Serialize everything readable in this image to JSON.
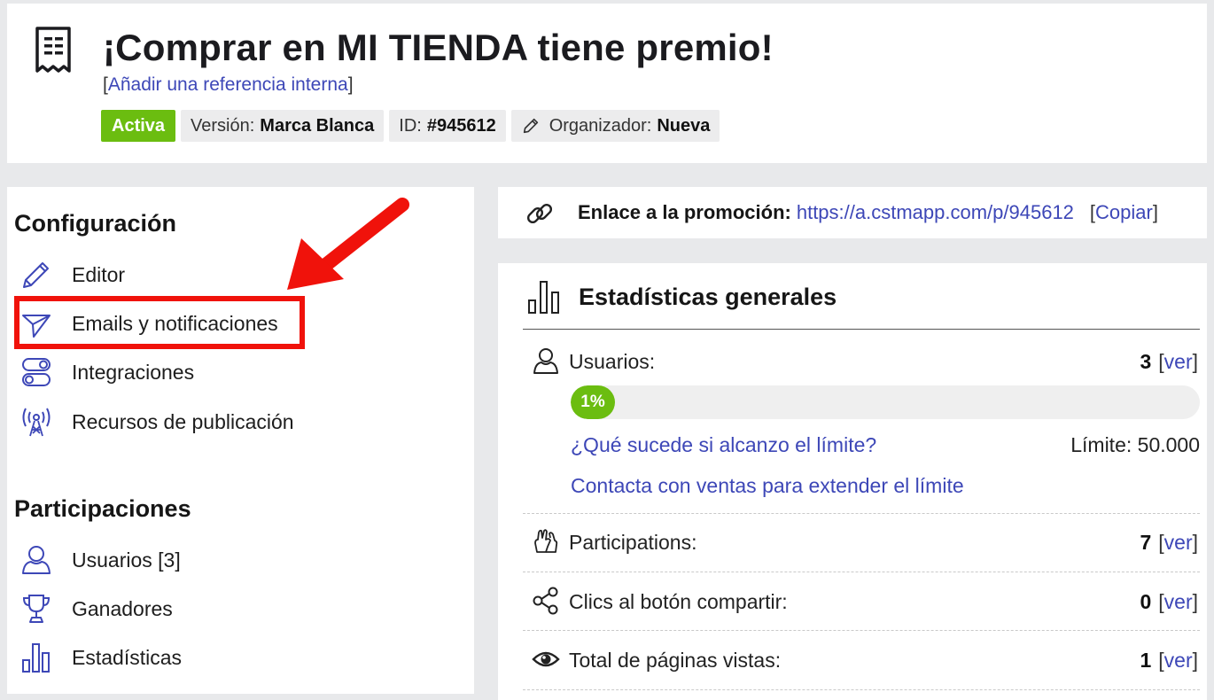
{
  "header": {
    "title": "¡Comprar en MI TIENDA tiene premio!",
    "ref_open": "[",
    "ref_link": "Añadir una referencia interna",
    "ref_close": "]",
    "status": "Activa",
    "version_label": "Versión:",
    "version_value": "Marca Blanca",
    "id_label": "ID:",
    "id_value": "#945612",
    "organizer_label": "Organizador:",
    "organizer_value": "Nueva"
  },
  "sidebar": {
    "config_title": "Configuración",
    "config_items": [
      {
        "label": "Editor",
        "icon": "pencil-icon"
      },
      {
        "label": "Emails y notificaciones",
        "icon": "send-icon"
      },
      {
        "label": "Integraciones",
        "icon": "toggles-icon"
      },
      {
        "label": "Recursos de publicación",
        "icon": "broadcast-icon"
      }
    ],
    "participations_title": "Participaciones",
    "participation_items": [
      {
        "label": "Usuarios [3]",
        "icon": "user-icon"
      },
      {
        "label": "Ganadores",
        "icon": "trophy-icon"
      },
      {
        "label": "Estadísticas",
        "icon": "bar-chart-icon"
      }
    ]
  },
  "promo_link": {
    "label": "Enlace a la promoción:",
    "url": "https://a.cstmapp.com/p/945612",
    "copy_open": "[",
    "copy": "Copiar",
    "copy_close": "]"
  },
  "stats": {
    "title": "Estadísticas generales",
    "users_label": "Usuarios:",
    "users_value": "3",
    "progress_text": "1%",
    "progress_fraction": 0.01,
    "limit_question": "¿Qué sucede si alcanzo el límite?",
    "limit_value": "Límite: 50.000",
    "contact_sales": "Contacta con ventas para extender el límite",
    "view_open": "[",
    "view": "ver",
    "view_close": "]",
    "rows": [
      {
        "label": "Participations:",
        "value": "7",
        "icon": "hands-icon"
      },
      {
        "label": "Clics al botón compartir:",
        "value": "0",
        "icon": "share-icon"
      },
      {
        "label": "Total de páginas vistas:",
        "value": "1",
        "icon": "eye-icon"
      }
    ]
  },
  "colors": {
    "accent_link": "#3d47b7",
    "active_green": "#6bbd10",
    "highlight_red": "#f0120b",
    "icon_blue": "#3d47b7"
  }
}
